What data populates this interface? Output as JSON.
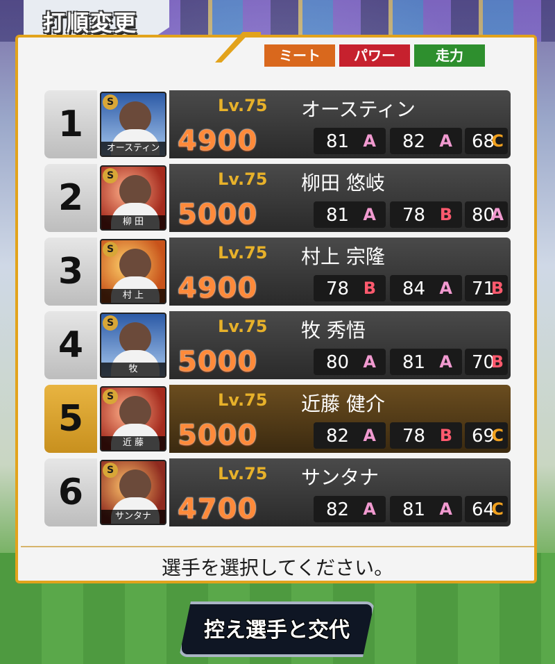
{
  "header": {
    "title": "打順変更"
  },
  "legend": {
    "meet": "ミート",
    "power": "パワー",
    "speed": "走力"
  },
  "players": [
    {
      "order": "1",
      "level": "Lv.75",
      "name": "オースティン",
      "plate": "オースティン",
      "power": "4900",
      "meet": "81",
      "meet_g": "A",
      "pwr": "82",
      "pwr_g": "A",
      "speed": "68",
      "speed_g": "C",
      "badge": "S"
    },
    {
      "order": "2",
      "level": "Lv.75",
      "name": "柳田 悠岐",
      "plate": "柳 田",
      "power": "5000",
      "meet": "81",
      "meet_g": "A",
      "pwr": "78",
      "pwr_g": "B",
      "speed": "80",
      "speed_g": "A",
      "badge": "S"
    },
    {
      "order": "3",
      "level": "Lv.75",
      "name": "村上 宗隆",
      "plate": "村 上",
      "power": "4900",
      "meet": "78",
      "meet_g": "B",
      "pwr": "84",
      "pwr_g": "A",
      "speed": "71",
      "speed_g": "B",
      "badge": "S"
    },
    {
      "order": "4",
      "level": "Lv.75",
      "name": "牧 秀悟",
      "plate": "牧",
      "power": "5000",
      "meet": "80",
      "meet_g": "A",
      "pwr": "81",
      "pwr_g": "A",
      "speed": "70",
      "speed_g": "B",
      "badge": "S"
    },
    {
      "order": "5",
      "level": "Lv.75",
      "name": "近藤 健介",
      "plate": "近 藤",
      "power": "5000",
      "meet": "82",
      "meet_g": "A",
      "pwr": "78",
      "pwr_g": "B",
      "speed": "69",
      "speed_g": "C",
      "badge": "S"
    },
    {
      "order": "6",
      "level": "Lv.75",
      "name": "サンタナ",
      "plate": "サンタナ",
      "power": "4700",
      "meet": "82",
      "meet_g": "A",
      "pwr": "81",
      "pwr_g": "A",
      "speed": "64",
      "speed_g": "C",
      "badge": "S"
    }
  ],
  "selected_order": "5",
  "prompt": "選手を選択してください。",
  "swap_button": "控え選手と交代"
}
